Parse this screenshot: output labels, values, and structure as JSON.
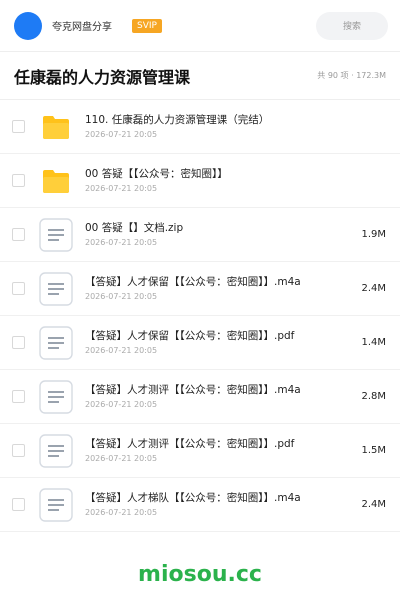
{
  "header": {
    "user_name": "夸克网盘分享",
    "vip_badge": "SVIP",
    "search_label": "搜索"
  },
  "folder": {
    "title": "任康磊的人力资源管理课",
    "summary": "共 90 项 · 172.3M"
  },
  "files": [
    {
      "icon": "folder",
      "name": "110. 任康磊的人力资源管理课（完结）",
      "date": "2026-07-21 20:05",
      "size": ""
    },
    {
      "icon": "folder",
      "name": "00 答疑【【公众号：密知圈】】",
      "date": "2026-07-21 20:05",
      "size": ""
    },
    {
      "icon": "document",
      "name": "00 答疑【】文档.zip",
      "date": "2026-07-21 20:05",
      "size": "1.9M"
    },
    {
      "icon": "document",
      "name": "【答疑】人才保留【【公众号：密知圈】】.m4a",
      "date": "2026-07-21 20:05",
      "size": "2.4M"
    },
    {
      "icon": "document",
      "name": "【答疑】人才保留【【公众号：密知圈】】.pdf",
      "date": "2026-07-21 20:05",
      "size": "1.4M"
    },
    {
      "icon": "document",
      "name": "【答疑】人才测评【【公众号：密知圈】】.m4a",
      "date": "2026-07-21 20:05",
      "size": "2.8M"
    },
    {
      "icon": "document",
      "name": "【答疑】人才测评【【公众号：密知圈】】.pdf",
      "date": "2026-07-21 20:05",
      "size": "1.5M"
    },
    {
      "icon": "document",
      "name": "【答疑】人才梯队【【公众号：密知圈】】.m4a",
      "date": "2026-07-21 20:05",
      "size": "2.4M"
    }
  ],
  "watermark": "miosou.cc",
  "colors": {
    "avatar": "#1e7bf5",
    "vip_badge": "#f6a623",
    "folder_icon": "#ffc21a",
    "watermark": "#2bb24c"
  }
}
